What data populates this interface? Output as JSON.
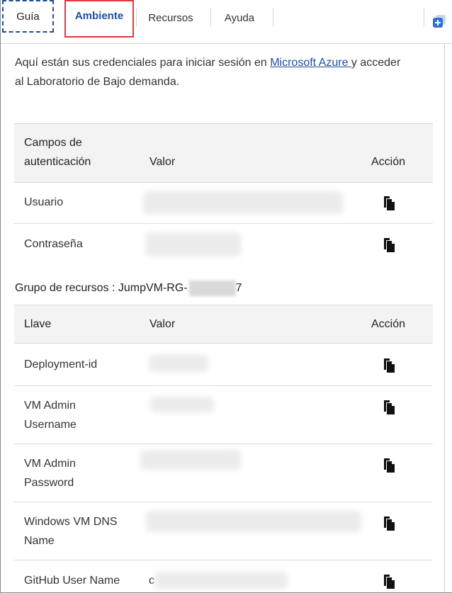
{
  "tabs": [
    {
      "label": "Guía"
    },
    {
      "label": "Ambiente"
    },
    {
      "label": "Recursos"
    },
    {
      "label": "Ayuda"
    }
  ],
  "intro": {
    "before": "Aquí están sus credenciales para iniciar sesión en ",
    "link": "Microsoft Azure ",
    "after": "y acceder al Laboratorio de Bajo demanda."
  },
  "auth_table": {
    "headers": {
      "field": "Campos de autenticación",
      "value": "Valor",
      "action": "Acción"
    },
    "rows": [
      {
        "key": "Usuario"
      },
      {
        "key": "Contraseña"
      }
    ]
  },
  "resource_group": {
    "label": "Grupo de recursos : JumpVM-RG-",
    "trailing": "7"
  },
  "keys_table": {
    "headers": {
      "key": "Llave",
      "value": "Valor",
      "action": "Acción"
    },
    "rows": [
      {
        "key": "Deployment-id"
      },
      {
        "key": "VM Admin Username"
      },
      {
        "key": "VM Admin Password"
      },
      {
        "key": "Windows VM DNS Name"
      },
      {
        "key": "GitHub User Name",
        "value_prefix": "c"
      }
    ]
  },
  "icons": {
    "copy": "copy-icon",
    "expand": "expand-panel-icon"
  },
  "colors": {
    "accent": "#1c4f9c",
    "highlight": "#e0393e"
  }
}
